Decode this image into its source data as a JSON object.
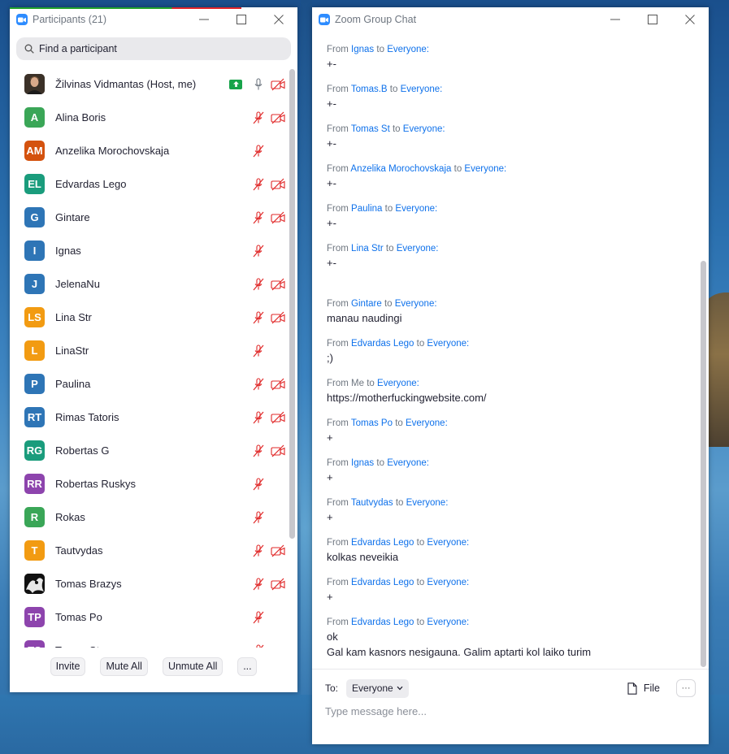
{
  "participants_window": {
    "title": "Participants (21)",
    "search_placeholder": "Find a participant",
    "participants": [
      {
        "name": "Žilvinas Vidmantas (Host, me)",
        "initials": "",
        "color": "#5b4a3a",
        "photo": true,
        "sharing": true,
        "mic": "on",
        "video": "off"
      },
      {
        "name": "Alina Boris",
        "initials": "A",
        "color": "#3aa657",
        "mic": "muted",
        "video": "off"
      },
      {
        "name": "Anzelika Morochovskaja",
        "initials": "AM",
        "color": "#d4520e",
        "mic": "muted",
        "video": "none"
      },
      {
        "name": "Edvardas Lego",
        "initials": "EL",
        "color": "#1a9c7c",
        "mic": "muted",
        "video": "off"
      },
      {
        "name": "Gintare",
        "initials": "G",
        "color": "#2e75b6",
        "mic": "muted",
        "video": "off"
      },
      {
        "name": "Ignas",
        "initials": "I",
        "color": "#2e75b6",
        "mic": "muted",
        "video": "none"
      },
      {
        "name": "JelenaNu",
        "initials": "J",
        "color": "#2e75b6",
        "mic": "muted",
        "video": "off"
      },
      {
        "name": "Lina Str",
        "initials": "LS",
        "color": "#f29b12",
        "mic": "muted",
        "video": "off"
      },
      {
        "name": "LinaStr",
        "initials": "L",
        "color": "#f29b12",
        "mic": "muted",
        "video": "none"
      },
      {
        "name": "Paulina",
        "initials": "P",
        "color": "#2e75b6",
        "mic": "muted",
        "video": "off"
      },
      {
        "name": "Rimas Tatoris",
        "initials": "RT",
        "color": "#2e75b6",
        "mic": "muted",
        "video": "off"
      },
      {
        "name": "Robertas G",
        "initials": "RG",
        "color": "#1a9c7c",
        "mic": "muted",
        "video": "off"
      },
      {
        "name": "Robertas Ruskys",
        "initials": "RR",
        "color": "#8d44ad",
        "mic": "muted",
        "video": "none"
      },
      {
        "name": "Rokas",
        "initials": "R",
        "color": "#3aa657",
        "mic": "muted",
        "video": "none"
      },
      {
        "name": "Tautvydas",
        "initials": "T",
        "color": "#f29b12",
        "mic": "muted",
        "video": "off"
      },
      {
        "name": "Tomas Brazys",
        "initials": "",
        "color": "#222222",
        "photo": true,
        "mic": "muted",
        "video": "off"
      },
      {
        "name": "Tomas Po",
        "initials": "TP",
        "color": "#8d44ad",
        "mic": "muted",
        "video": "none"
      },
      {
        "name": "Tomas St",
        "initials": "TS",
        "color": "#8d44ad",
        "mic": "muted",
        "video": "none"
      }
    ],
    "footer": {
      "invite_label": "Invite",
      "mute_all_label": "Mute All",
      "unmute_all_label": "Unmute All",
      "more_label": "..."
    }
  },
  "chat_window": {
    "title": "Zoom Group Chat",
    "messages": [
      {
        "from": "Ignas",
        "to": "Everyone:",
        "lines": [
          "+-"
        ]
      },
      {
        "from": "Tomas.B",
        "to": "Everyone:",
        "lines": [
          "+-"
        ]
      },
      {
        "from": "Tomas St",
        "to": "Everyone:",
        "lines": [
          "+-"
        ]
      },
      {
        "from": "Anzelika Morochovskaja",
        "to": "Everyone:",
        "lines": [
          "+-"
        ]
      },
      {
        "from": "Paulina",
        "to": "Everyone:",
        "lines": [
          "+-"
        ]
      },
      {
        "from": "Lina Str",
        "to": "Everyone:",
        "lines": [
          "+-"
        ]
      },
      {
        "from": "Gintare",
        "to": "Everyone:",
        "lines": [
          "manau naudingi"
        ]
      },
      {
        "from": "Edvardas Lego",
        "to": "Everyone:",
        "lines": [
          ";)"
        ]
      },
      {
        "from": "Me",
        "to": "Everyone:",
        "lines": [
          "https://motherfuckingwebsite.com/"
        ]
      },
      {
        "from": "Tomas Po",
        "to": "Everyone:",
        "lines": [
          "+"
        ]
      },
      {
        "from": "Ignas",
        "to": "Everyone:",
        "lines": [
          "+"
        ]
      },
      {
        "from": "Tautvydas",
        "to": "Everyone:",
        "lines": [
          "+"
        ]
      },
      {
        "from": "Edvardas Lego",
        "to": "Everyone:",
        "lines": [
          "kolkas neveikia"
        ]
      },
      {
        "from": "Edvardas Lego",
        "to": "Everyone:",
        "lines": [
          "+"
        ]
      },
      {
        "from": "Edvardas Lego",
        "to": "Everyone:",
        "lines": [
          "ok",
          "Gal kam kasnors nesigauna. Galim aptarti kol laiko turim"
        ]
      }
    ],
    "from_word": "From",
    "to_word": "to",
    "to_label": "To:",
    "to_value": "Everyone",
    "file_label": "File",
    "more_label": "···",
    "input_placeholder": "Type message here..."
  }
}
